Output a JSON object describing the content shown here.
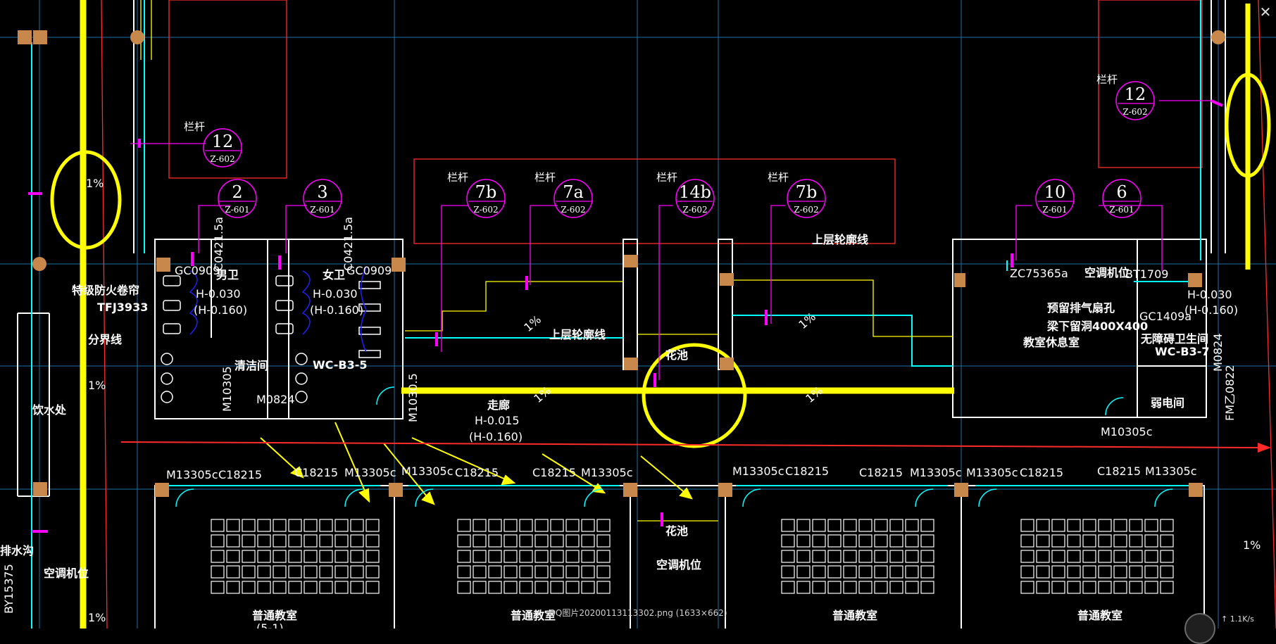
{
  "viewer": {
    "caption": "QQ图片20200113113302.png (1633×662)",
    "close_icon": "close-icon",
    "speed": "↑ 1.1K/s"
  },
  "colors": {
    "background": "#000000",
    "axis": "#1e6fa8",
    "wall": "#ffffff",
    "cyan": "#00ffff",
    "yellow": "#ffff00",
    "magenta": "#ff00ff",
    "red": "#ff2b2b",
    "green": "#1fd51f",
    "blue": "#2020ff",
    "column": "#c8884c"
  },
  "callouts": [
    {
      "num": "12",
      "ref": "Z-602",
      "label": "栏杆"
    },
    {
      "num": "2",
      "ref": "Z-601"
    },
    {
      "num": "3",
      "ref": "Z-601"
    },
    {
      "num": "7b",
      "ref": "Z-602",
      "label": "栏杆"
    },
    {
      "num": "7a",
      "ref": "Z-602",
      "label": "栏杆"
    },
    {
      "num": "14b",
      "ref": "Z-602",
      "label": "栏杆"
    },
    {
      "num": "7b",
      "ref": "Z-602",
      "label": "栏杆"
    },
    {
      "num": "10",
      "ref": "Z-601"
    },
    {
      "num": "6",
      "ref": "Z-601"
    },
    {
      "num": "12",
      "ref": "Z-602",
      "label": "栏杆"
    }
  ],
  "labels": {
    "men_toilet": "男卫",
    "women_toilet": "女卫",
    "h_men": "H-0.030",
    "h_men2": "(H-0.160)",
    "h_women": "H-0.030",
    "h_women2": "(H-0.160)",
    "gc0909_a": "GC0909",
    "gc0909_b": "GC0909",
    "c0421_a": "C0421.5a",
    "c0421_b": "C0421.5a",
    "cleaning": "清洁间",
    "wc": "WC-B3-5",
    "m1030": "M10305",
    "m0824": "M0824",
    "m1030b": "M1030.5",
    "fire_shutter": "特级防火卷帘",
    "tfjs": "TFJ3933",
    "boundary": "分界线",
    "drinking": "饮水处",
    "upper_outline1": "上层轮廓线",
    "upper_outline2": "上层轮廓线",
    "flower1": "花池",
    "flower2": "花池",
    "ac_pos1": "空调机位",
    "ac_pos2": "空调机位",
    "ac_pos3": "空调机位",
    "corridor": "走廊",
    "h_corr": "H-0.015",
    "h_corr2": "(H-0.160)",
    "zc": "ZC75365a",
    "vent": "预留排气扇孔",
    "beam": "梁下留洞400X400",
    "lounge": "教室休息室",
    "bt": "BT1709",
    "gc1409": "GC1409a",
    "teacher_wc": "无障碍卫生间",
    "wcb7": "WC-B3-7",
    "power": "弱电间",
    "m0824b": "M0824",
    "fm": "FM乙0822",
    "m10305c": "M10305c",
    "h_r": "H-0.030",
    "h_r2": "(H-0.160)",
    "by": "BY15375",
    "drain": "排水沟",
    "slope": "1%",
    "classroom": "普通教室",
    "room_no": "(5-1)",
    "m13305c": "M13305c",
    "c18215": "C18215"
  }
}
